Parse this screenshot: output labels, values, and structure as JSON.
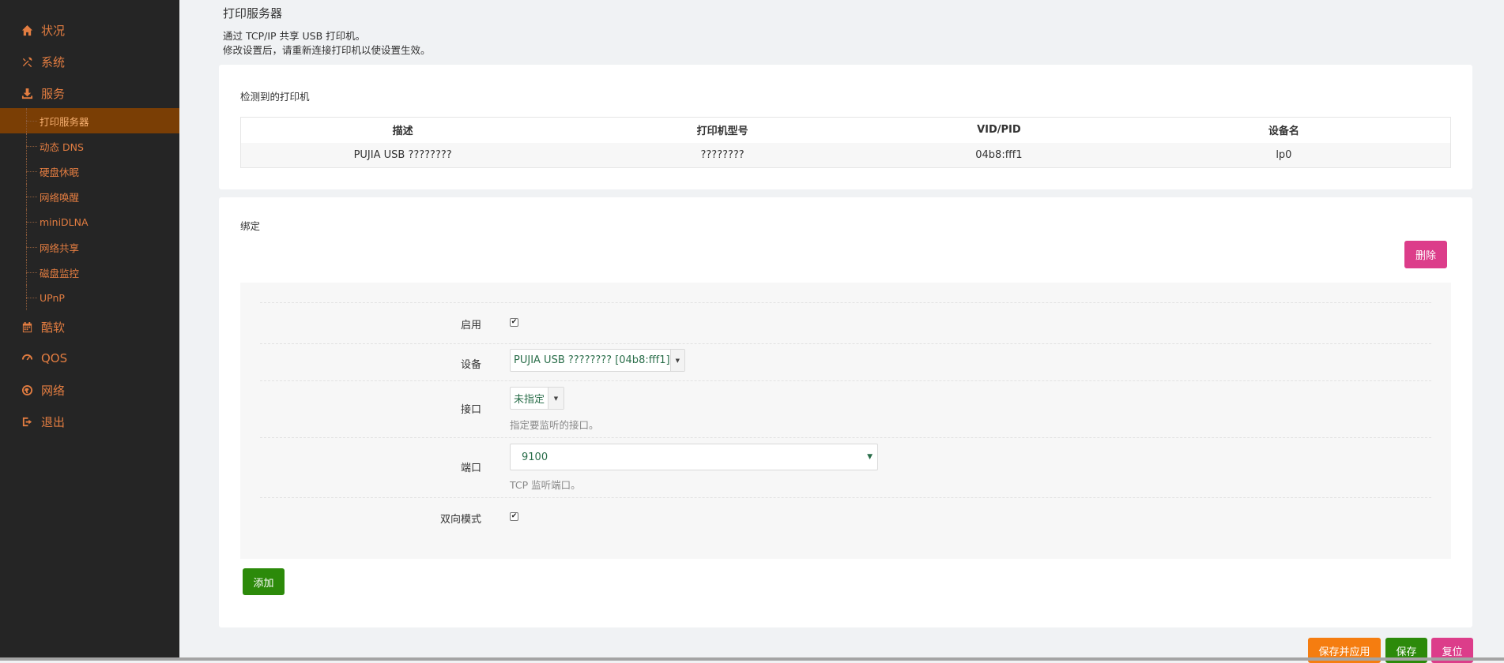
{
  "sidebar": {
    "top_items": [
      {
        "label": "状况",
        "icon": "home-icon"
      },
      {
        "label": "系统",
        "icon": "tools-icon"
      },
      {
        "label": "服务",
        "icon": "download-icon"
      }
    ],
    "sub_items": [
      {
        "label": "打印服务器",
        "active": true
      },
      {
        "label": "动态 DNS"
      },
      {
        "label": "硬盘休眠"
      },
      {
        "label": "网络唤醒"
      },
      {
        "label": "miniDLNA"
      },
      {
        "label": "网络共享"
      },
      {
        "label": "磁盘监控"
      },
      {
        "label": "UPnP"
      }
    ],
    "bottom_items": [
      {
        "label": "酷软",
        "icon": "calendar-icon"
      },
      {
        "label": "QOS",
        "icon": "gauge-icon"
      },
      {
        "label": "网络",
        "icon": "globe-icon"
      },
      {
        "label": "退出",
        "icon": "logout-icon"
      }
    ]
  },
  "page": {
    "title": "打印服务器",
    "desc_line1": "通过 TCP/IP 共享 USB 打印机。",
    "desc_line2": "修改设置后，请重新连接打印机以使设置生效。"
  },
  "detected": {
    "title": "检测到的打印机",
    "columns": [
      "描述",
      "打印机型号",
      "VID/PID",
      "设备名"
    ],
    "rows": [
      [
        "PUJIA USB ????????",
        "????????",
        "04b8:fff1",
        "lp0"
      ]
    ]
  },
  "binding": {
    "title": "绑定",
    "delete_label": "删除",
    "add_label": "添加",
    "fields": {
      "enable": {
        "label": "启用",
        "checked": true
      },
      "device": {
        "label": "设备",
        "value": "PUJIA USB ???????? [04b8:fff1]"
      },
      "interface": {
        "label": "接口",
        "value": "未指定",
        "hint": "指定要监听的接口。"
      },
      "port": {
        "label": "端口",
        "value": "9100",
        "hint": "TCP 监听端口。"
      },
      "bidirectional": {
        "label": "双向模式",
        "checked": true
      }
    }
  },
  "footer": {
    "save_apply_label": "保存并应用",
    "save_label": "保存",
    "reset_label": "复位"
  },
  "colors": {
    "sidebar_bg": "#252525",
    "accent_orange": "#e37d41",
    "active_bg": "#7a3e05",
    "pink": "#dc3d8a",
    "green": "#2c8a0a",
    "orange_btn": "#f57d10"
  }
}
